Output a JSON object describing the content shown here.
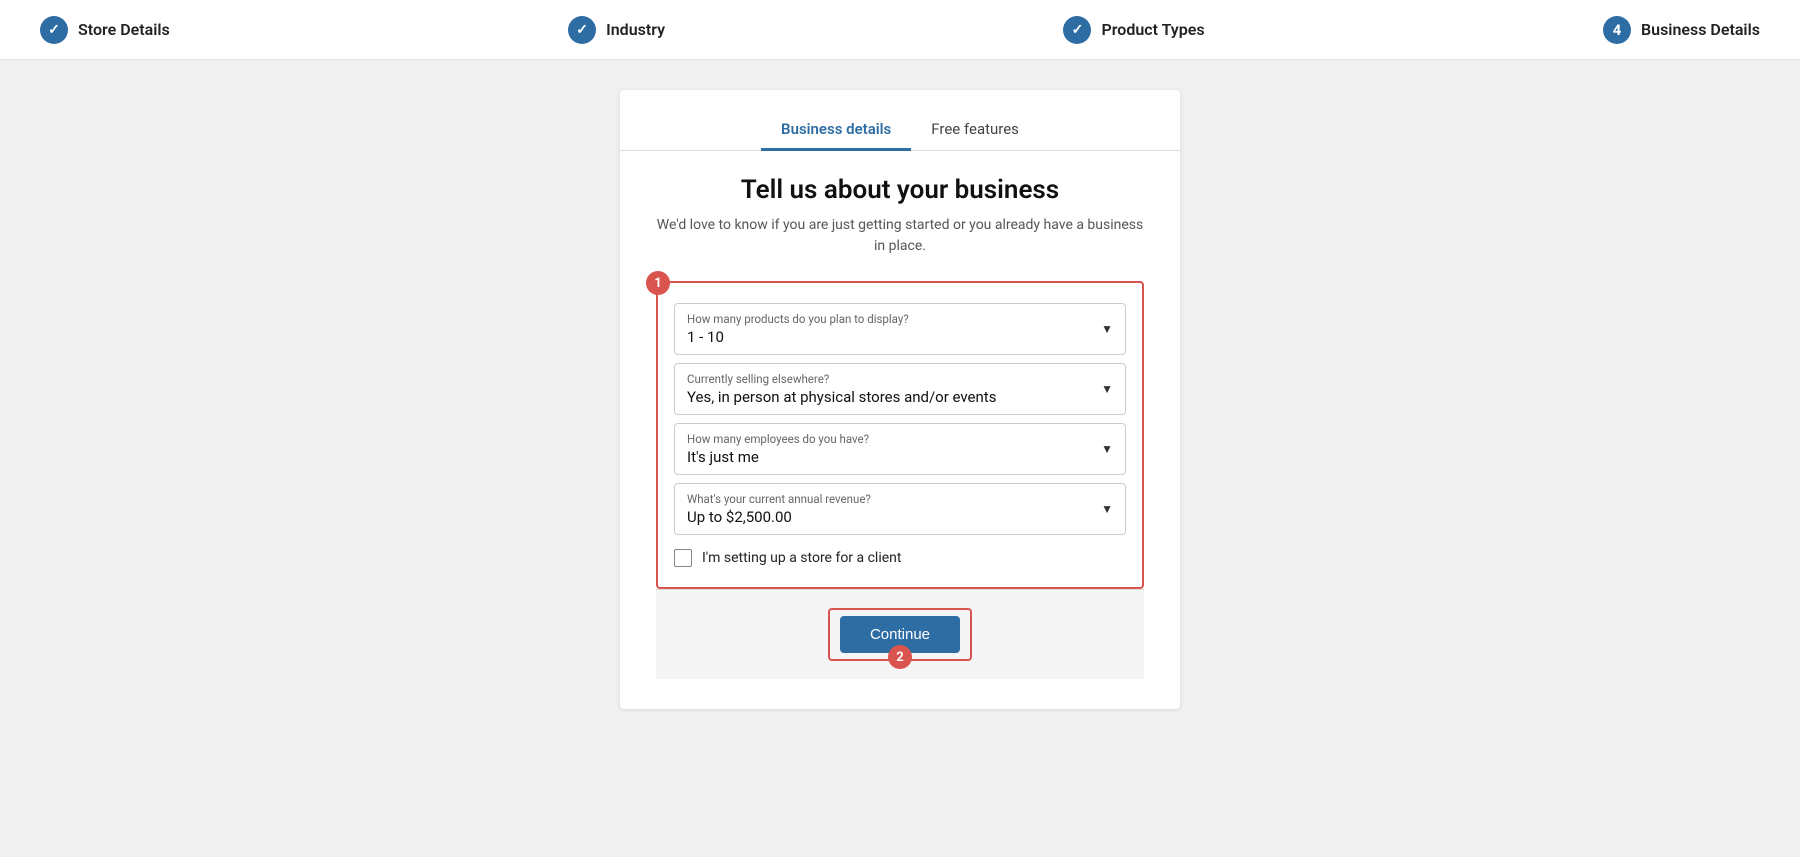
{
  "stepper": {
    "steps": [
      {
        "id": "store-details",
        "label": "Store Details",
        "type": "check"
      },
      {
        "id": "industry",
        "label": "Industry",
        "type": "check"
      },
      {
        "id": "product-types",
        "label": "Product Types",
        "type": "check"
      },
      {
        "id": "business-details",
        "label": "Business Details",
        "type": "number",
        "number": "4"
      }
    ]
  },
  "tabs": [
    {
      "id": "business-details",
      "label": "Business details",
      "active": true
    },
    {
      "id": "free-features",
      "label": "Free features",
      "active": false
    }
  ],
  "main": {
    "title": "Tell us about your business",
    "subtitle": "We'd love to know if you are just getting started or you already have a business in place.",
    "badge1": "1",
    "badge2": "2"
  },
  "fields": [
    {
      "id": "products-count",
      "label": "How many products do you plan to display?",
      "value": "1 - 10"
    },
    {
      "id": "selling-elsewhere",
      "label": "Currently selling elsewhere?",
      "value": "Yes, in person at physical stores and/or events"
    },
    {
      "id": "employees",
      "label": "How many employees do you have?",
      "value": "It's just me"
    },
    {
      "id": "annual-revenue",
      "label": "What's your current annual revenue?",
      "value": "Up to $2,500.00"
    }
  ],
  "checkbox": {
    "label": "I'm setting up a store for a client"
  },
  "continue_button": {
    "label": "Continue"
  }
}
